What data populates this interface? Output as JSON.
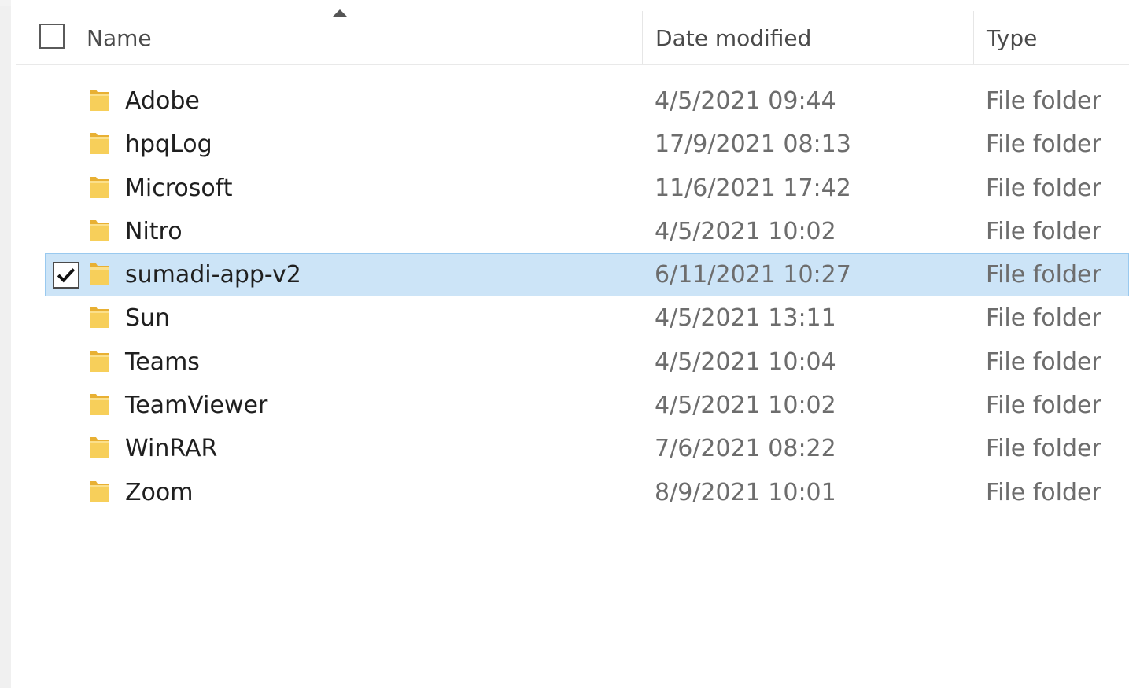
{
  "header": {
    "name_label": "Name",
    "date_label": "Date modified",
    "type_label": "Type"
  },
  "files": [
    {
      "name": "Adobe",
      "date": "4/5/2021 09:44",
      "type": "File folder",
      "selected": false
    },
    {
      "name": "hpqLog",
      "date": "17/9/2021 08:13",
      "type": "File folder",
      "selected": false
    },
    {
      "name": "Microsoft",
      "date": "11/6/2021 17:42",
      "type": "File folder",
      "selected": false
    },
    {
      "name": "Nitro",
      "date": "4/5/2021 10:02",
      "type": "File folder",
      "selected": false
    },
    {
      "name": "sumadi-app-v2",
      "date": "6/11/2021 10:27",
      "type": "File folder",
      "selected": true
    },
    {
      "name": "Sun",
      "date": "4/5/2021 13:11",
      "type": "File folder",
      "selected": false
    },
    {
      "name": "Teams",
      "date": "4/5/2021 10:04",
      "type": "File folder",
      "selected": false
    },
    {
      "name": "TeamViewer",
      "date": "4/5/2021 10:02",
      "type": "File folder",
      "selected": false
    },
    {
      "name": "WinRAR",
      "date": "7/6/2021 08:22",
      "type": "File folder",
      "selected": false
    },
    {
      "name": "Zoom",
      "date": "8/9/2021 10:01",
      "type": "File folder",
      "selected": false
    }
  ],
  "icons": {
    "folder": "folder-icon",
    "check": "checkmark-icon",
    "sort": "sort-ascending-icon"
  },
  "colors": {
    "selection_fill": "#cce4f7",
    "selection_border": "#99c9ef",
    "folder_yellow": "#f4c542"
  }
}
